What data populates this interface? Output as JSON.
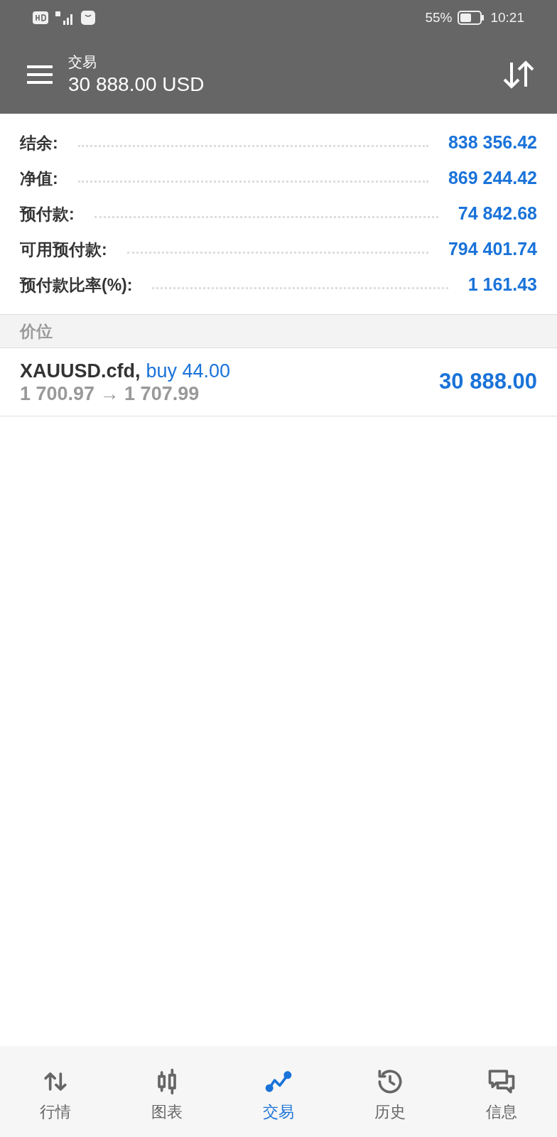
{
  "status_bar": {
    "battery": "55%",
    "time": "10:21"
  },
  "header": {
    "title": "交易",
    "balance": "30 888.00 USD"
  },
  "summary": [
    {
      "label": "结余:",
      "value": "838 356.42"
    },
    {
      "label": "净值:",
      "value": "869 244.42"
    },
    {
      "label": "预付款:",
      "value": "74 842.68"
    },
    {
      "label": "可用预付款:",
      "value": "794 401.74"
    },
    {
      "label": "预付款比率(%):",
      "value": "1 161.43"
    }
  ],
  "section": {
    "title": "价位"
  },
  "positions": [
    {
      "symbol": "XAUUSD.cfd,",
      "order": "buy 44.00",
      "prices": "1 700.97 → 1 707.99",
      "profit": "30 888.00"
    }
  ],
  "nav_tabs": [
    {
      "kind": "quotes",
      "label": "行情",
      "selected": false
    },
    {
      "kind": "chart",
      "label": "图表",
      "selected": false
    },
    {
      "kind": "trade",
      "label": "交易",
      "selected": true
    },
    {
      "kind": "history",
      "label": "历史",
      "selected": false
    },
    {
      "kind": "messages",
      "label": "信息",
      "selected": false
    }
  ]
}
